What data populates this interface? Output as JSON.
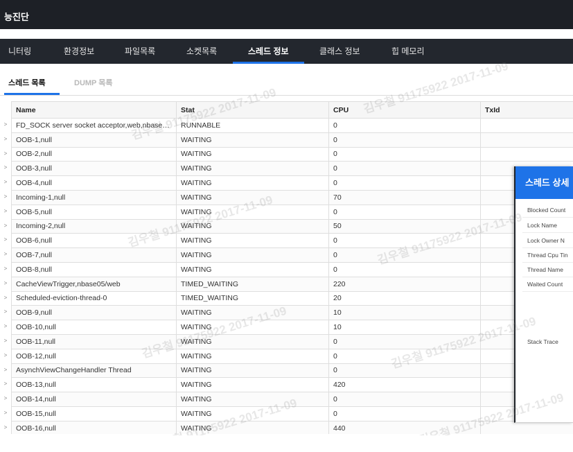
{
  "window": {
    "title": "능진단"
  },
  "nav": {
    "tabs": [
      {
        "label": "니터링",
        "active": false
      },
      {
        "label": "환경정보",
        "active": false
      },
      {
        "label": "파일목록",
        "active": false
      },
      {
        "label": "소켓목록",
        "active": false
      },
      {
        "label": "스레드 정보",
        "active": true
      },
      {
        "label": "클래스 정보",
        "active": false
      },
      {
        "label": "힙 메모리",
        "active": false
      }
    ]
  },
  "subtabs": {
    "thread_list": "스레드 목록",
    "dump_list": "DUMP 목록"
  },
  "table": {
    "columns": [
      "Name",
      "Stat",
      "CPU",
      "TxId"
    ],
    "rows": [
      [
        "FD_SOCK server socket acceptor,web,nbase0···",
        "RUNNABLE",
        "0",
        ""
      ],
      [
        "OOB-1,null",
        "WAITING",
        "0",
        ""
      ],
      [
        "OOB-2,null",
        "WAITING",
        "0",
        ""
      ],
      [
        "OOB-3,null",
        "WAITING",
        "0",
        ""
      ],
      [
        "OOB-4,null",
        "WAITING",
        "0",
        ""
      ],
      [
        "Incoming-1,null",
        "WAITING",
        "70",
        ""
      ],
      [
        "OOB-5,null",
        "WAITING",
        "0",
        ""
      ],
      [
        "Incoming-2,null",
        "WAITING",
        "50",
        ""
      ],
      [
        "OOB-6,null",
        "WAITING",
        "0",
        ""
      ],
      [
        "OOB-7,null",
        "WAITING",
        "0",
        ""
      ],
      [
        "OOB-8,null",
        "WAITING",
        "0",
        ""
      ],
      [
        "CacheViewTrigger,nbase05/web",
        "TIMED_WAITING",
        "220",
        ""
      ],
      [
        "Scheduled-eviction-thread-0",
        "TIMED_WAITING",
        "20",
        ""
      ],
      [
        "OOB-9,null",
        "WAITING",
        "10",
        ""
      ],
      [
        "OOB-10,null",
        "WAITING",
        "10",
        ""
      ],
      [
        "OOB-11,null",
        "WAITING",
        "0",
        ""
      ],
      [
        "OOB-12,null",
        "WAITING",
        "0",
        ""
      ],
      [
        "AsynchViewChangeHandler Thread",
        "WAITING",
        "0",
        ""
      ],
      [
        "OOB-13,null",
        "WAITING",
        "420",
        ""
      ],
      [
        "OOB-14,null",
        "WAITING",
        "0",
        ""
      ],
      [
        "OOB-15,null",
        "WAITING",
        "0",
        ""
      ],
      [
        "OOB-16,null",
        "WAITING",
        "440",
        ""
      ]
    ]
  },
  "row_marks": [
    ">",
    ">",
    ">",
    ">",
    ">",
    ">",
    ">",
    ">",
    ">",
    ">",
    ">",
    ">",
    ">",
    ">",
    ">",
    ">",
    ">",
    ">",
    ">",
    ">",
    ">",
    ">"
  ],
  "detail_panel": {
    "title": "스레드 상세",
    "labels": [
      "Blocked Count",
      "Lock Name",
      "Lock Owner N",
      "Thread Cpu Tin",
      "Thread Name",
      "Waited Count",
      "Stack Trace"
    ]
  },
  "watermarks": [
    "김우철 91175922 2017-11-09",
    "김우철 91175922 2017-11-09",
    "김우철 91175922 2017-11-09",
    "김우철 91175922 2017-11-09",
    "김우철 91175922 2017-11-09",
    "김우철 91175922 2017-11-09",
    "김우철 91175922 2017-11-09",
    "김우철 91175922 2017-11-09"
  ],
  "colors": {
    "accent": "#1e73e8",
    "header_bg": "#1d2026",
    "nav_bg": "#23272e"
  }
}
